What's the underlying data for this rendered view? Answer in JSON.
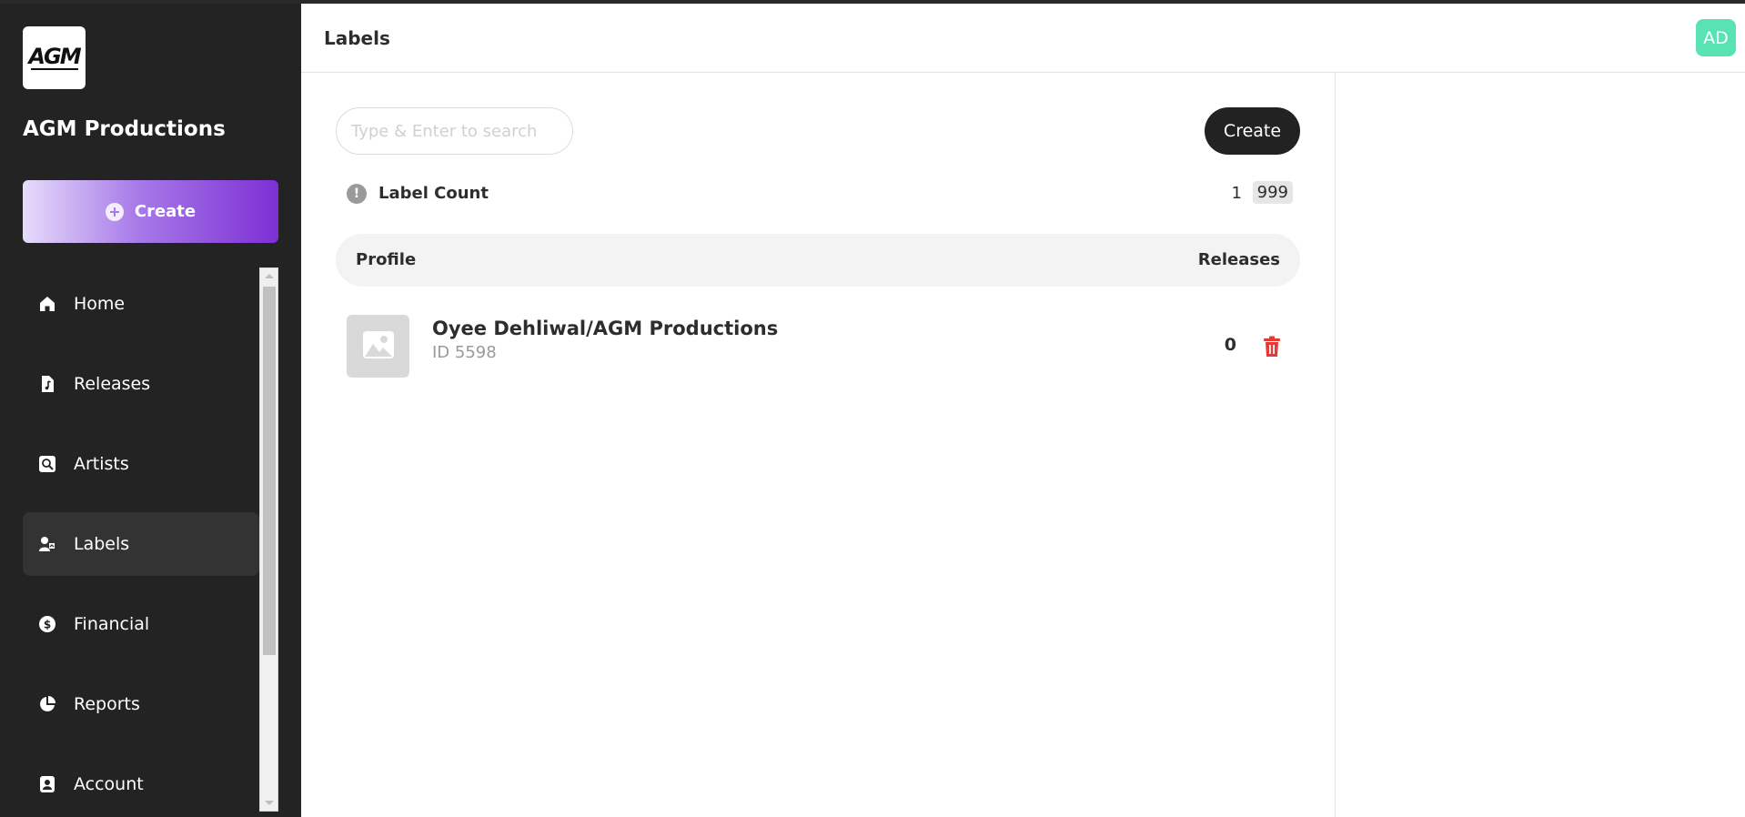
{
  "brand": {
    "logo_text": "AGM",
    "name": "AGM Productions"
  },
  "sidebar": {
    "create_label": "Create",
    "items": [
      {
        "label": "Home",
        "icon": "home-icon"
      },
      {
        "label": "Releases",
        "icon": "music-file-icon"
      },
      {
        "label": "Artists",
        "icon": "artist-icon"
      },
      {
        "label": "Labels",
        "icon": "label-icon",
        "active": true
      },
      {
        "label": "Financial",
        "icon": "dollar-icon"
      },
      {
        "label": "Reports",
        "icon": "pie-chart-icon"
      },
      {
        "label": "Account",
        "icon": "account-icon"
      }
    ]
  },
  "header": {
    "title": "Labels",
    "avatar_initials": "AD"
  },
  "search": {
    "placeholder": "Type & Enter to search",
    "value": ""
  },
  "toolbar": {
    "create_label": "Create"
  },
  "count": {
    "label": "Label Count",
    "value": "1",
    "limit": "999"
  },
  "table": {
    "columns": {
      "profile": "Profile",
      "releases": "Releases"
    },
    "rows": [
      {
        "name": "Oyee Dehliwal/AGM Productions",
        "id_text": "ID 5598",
        "releases": "0"
      }
    ]
  },
  "colors": {
    "accent_gradient_start": "#e6dcfb",
    "accent_gradient_end": "#7d2fd4",
    "avatar_bg": "#59e3b3",
    "delete_red": "#e53935",
    "sidebar_bg": "#232323"
  }
}
